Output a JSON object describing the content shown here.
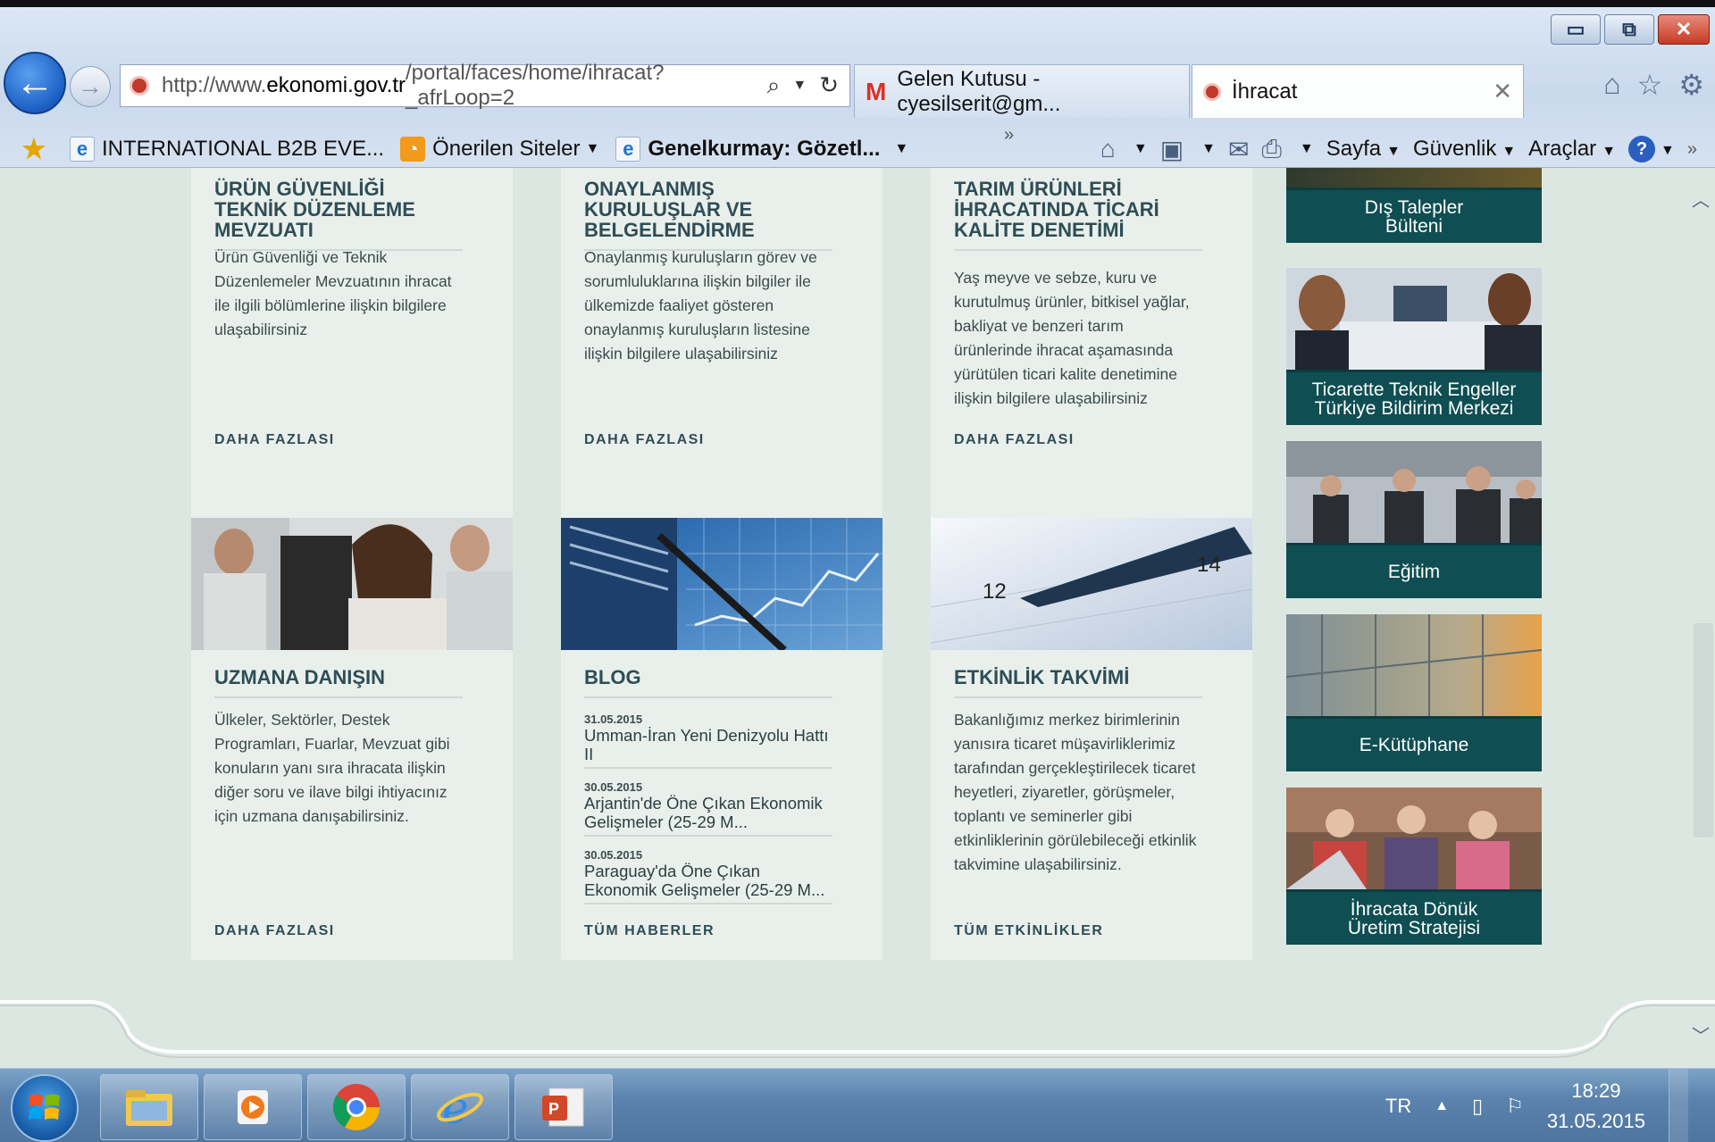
{
  "browser": {
    "url_prefix": "http://www.",
    "url_domain": "ekonomi.gov.tr",
    "url_path": "/portal/faces/home/ihracat?_afrLoop=2",
    "tabs": [
      {
        "label": "Gelen Kutusu - cyesilserit@gm..."
      },
      {
        "label": "İhracat"
      }
    ],
    "favorites": [
      {
        "label": "INTERNATIONAL B2B EVE..."
      },
      {
        "label": "Önerilen Siteler"
      },
      {
        "label": "Genelkurmay: Gözetl..."
      }
    ],
    "commands": {
      "page": "Sayfa",
      "safety": "Güvenlik",
      "tools": "Araçlar"
    }
  },
  "cards_row1": [
    {
      "title": "ÜRÜN GÜVENLİĞİ TEKNİK DÜZENLEME MEVZUATI",
      "text": "Ürün Güvenliği ve Teknik Düzenlemeler Mevzuatının ihracat ile ilgili bölümlerine ilişkin bilgilere ulaşabilirsiniz",
      "more": "DAHA FAZLASI"
    },
    {
      "title": "ONAYLANMIŞ KURULUŞLAR VE BELGELENDİRME",
      "text": "Onaylanmış kuruluşların görev ve sorumluluklarına ilişkin bilgiler ile ülkemizde faaliyet gösteren onaylanmış kuruluşların listesine ilişkin bilgilere ulaşabilirsiniz",
      "more": "DAHA FAZLASI"
    },
    {
      "title": "TARIM ÜRÜNLERİ İHRACATINDA TİCARİ KALİTE DENETİMİ",
      "text": "Yaş meyve ve sebze, kuru ve kurutulmuş ürünler, bitkisel yağlar, bakliyat ve benzeri tarım ürünlerinde ihracat aşamasında yürütülen ticari kalite denetimine ilişkin bilgilere ulaşabilirsiniz",
      "more": "DAHA FAZLASI"
    }
  ],
  "cards_row2": {
    "expert": {
      "title": "UZMANA DANIŞIN",
      "text": "Ülkeler, Sektörler, Destek Programları, Fuarlar, Mevzuat gibi konuların yanı sıra ihracata ilişkin diğer soru ve ilave bilgi ihtiyacınız için uzmana danışabilirsiniz.",
      "more": "DAHA FAZLASI"
    },
    "blog": {
      "title": "BLOG",
      "items": [
        {
          "date": "31.05.2015",
          "title": "Umman-İran Yeni Denizyolu Hattı II"
        },
        {
          "date": "30.05.2015",
          "title": "Arjantin'de Öne Çıkan Ekonomik Gelişmeler (25-29 M..."
        },
        {
          "date": "30.05.2015",
          "title": "Paraguay'da Öne Çıkan Ekonomik Gelişmeler (25-29 M..."
        }
      ],
      "more": "TÜM HABERLER"
    },
    "events": {
      "title": "ETKİNLİK TAKVİMİ",
      "text": "Bakanlığımız merkez birimlerinin yanısıra ticaret müşavirliklerimiz tarafından gerçekleştirilecek ticaret heyetleri, ziyaretler, görüşmeler, toplantı ve seminerler gibi etkinliklerinin görülebileceği etkinlik takvimine ulaşabilirsiniz.",
      "more": "TÜM ETKİNLİKLER"
    }
  },
  "sidebar": [
    {
      "label": "Dış Talepler\nBülteni"
    },
    {
      "label": "Ticarette Teknik Engeller\nTürkiye Bildirim Merkezi"
    },
    {
      "label": "Eğitim"
    },
    {
      "label": "E-Kütüphane"
    },
    {
      "label": "İhracata Dönük\nÜretim Stratejisi"
    }
  ],
  "taskbar": {
    "language": "TR",
    "time": "18:29",
    "date": "31.05.2015"
  },
  "colors": {
    "sidebar_button": "#0f4e52",
    "card_bg": "#e9f0ec",
    "page_bg": "#dde7e2",
    "title_text": "#2f4d55"
  }
}
